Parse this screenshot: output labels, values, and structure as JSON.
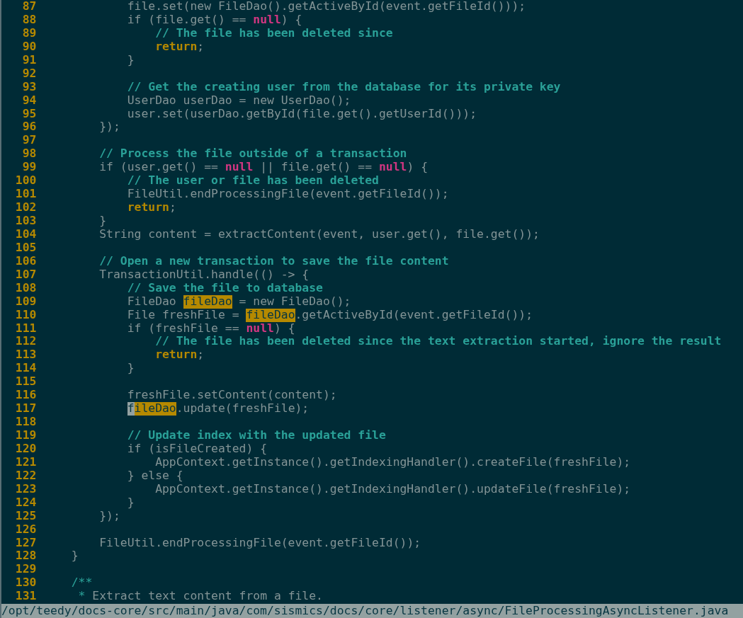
{
  "lines": [
    {
      "number": "87",
      "segments": [
        {
          "text": "            file.set(new FileDao().getActiveById(event.getFileId()));",
          "kind": "code"
        }
      ]
    },
    {
      "number": "88",
      "segments": [
        {
          "text": "            if (file.get() == ",
          "kind": "code"
        },
        {
          "text": "null",
          "kind": "null"
        },
        {
          "text": ") {",
          "kind": "code"
        }
      ]
    },
    {
      "number": "89",
      "segments": [
        {
          "text": "                // The file has been deleted since",
          "kind": "comment"
        }
      ]
    },
    {
      "number": "90",
      "segments": [
        {
          "text": "                return",
          "kind": "return"
        },
        {
          "text": ";",
          "kind": "code"
        }
      ]
    },
    {
      "number": "91",
      "segments": [
        {
          "text": "            }",
          "kind": "code"
        }
      ]
    },
    {
      "number": "92"
    },
    {
      "number": "93",
      "segments": [
        {
          "text": "            // Get the creating user from the database for its private key",
          "kind": "comment"
        }
      ]
    },
    {
      "number": "94",
      "segments": [
        {
          "text": "            UserDao userDao = new UserDao();",
          "kind": "code"
        }
      ]
    },
    {
      "number": "95",
      "segments": [
        {
          "text": "            user.set(userDao.getById(file.get().getUserId()));",
          "kind": "code"
        }
      ]
    },
    {
      "number": "96",
      "segments": [
        {
          "text": "        });",
          "kind": "code"
        }
      ]
    },
    {
      "number": "97"
    },
    {
      "number": "98",
      "segments": [
        {
          "text": "        // Process the file outside of a transaction",
          "kind": "comment"
        }
      ]
    },
    {
      "number": "99",
      "segments": [
        {
          "text": "        if (user.get() == ",
          "kind": "code"
        },
        {
          "text": "null",
          "kind": "null"
        },
        {
          "text": " || file.get() == ",
          "kind": "code"
        },
        {
          "text": "null",
          "kind": "null"
        },
        {
          "text": ") {",
          "kind": "code"
        }
      ]
    },
    {
      "number": "100",
      "segments": [
        {
          "text": "            // The user or file has been deleted",
          "kind": "comment"
        }
      ]
    },
    {
      "number": "101",
      "segments": [
        {
          "text": "            FileUtil.endProcessingFile(event.getFileId());",
          "kind": "code"
        }
      ]
    },
    {
      "number": "102",
      "segments": [
        {
          "text": "            return",
          "kind": "return"
        },
        {
          "text": ";",
          "kind": "code"
        }
      ]
    },
    {
      "number": "103",
      "segments": [
        {
          "text": "        }",
          "kind": "code"
        }
      ]
    },
    {
      "number": "104",
      "segments": [
        {
          "text": "        String content = extractContent(event, user.get(), file.get());",
          "kind": "code"
        }
      ]
    },
    {
      "number": "105"
    },
    {
      "number": "106",
      "segments": [
        {
          "text": "        // Open a new transaction to save the file content",
          "kind": "comment"
        }
      ]
    },
    {
      "number": "107",
      "segments": [
        {
          "text": "        TransactionUtil.handle(() -> {",
          "kind": "code"
        }
      ]
    },
    {
      "number": "108",
      "segments": [
        {
          "text": "            // Save the file to database",
          "kind": "comment"
        }
      ]
    },
    {
      "number": "109",
      "segments": [
        {
          "text": "            FileDao ",
          "kind": "code"
        },
        {
          "text": "fileDao",
          "kind": "match"
        },
        {
          "text": " = new FileDao();",
          "kind": "code"
        }
      ]
    },
    {
      "number": "110",
      "segments": [
        {
          "text": "            File freshFile = ",
          "kind": "code"
        },
        {
          "text": "fileDao",
          "kind": "match"
        },
        {
          "text": ".getActiveById(event.getFileId());",
          "kind": "code"
        }
      ]
    },
    {
      "number": "111",
      "segments": [
        {
          "text": "            if (freshFile == ",
          "kind": "code"
        },
        {
          "text": "null",
          "kind": "null"
        },
        {
          "text": ") {",
          "kind": "code"
        }
      ]
    },
    {
      "number": "112",
      "segments": [
        {
          "text": "                // The file has been deleted since the text extraction started, ignore the result",
          "kind": "comment"
        }
      ]
    },
    {
      "number": "113",
      "segments": [
        {
          "text": "                return",
          "kind": "return"
        },
        {
          "text": ";",
          "kind": "code"
        }
      ]
    },
    {
      "number": "114",
      "segments": [
        {
          "text": "            }",
          "kind": "code"
        }
      ]
    },
    {
      "number": "115"
    },
    {
      "number": "116",
      "segments": [
        {
          "text": "            freshFile.setContent(content);",
          "kind": "code"
        }
      ]
    },
    {
      "number": "117",
      "segments": [
        {
          "text": "            f",
          "kind": "cursor"
        },
        {
          "text": "ileDao",
          "kind": "match"
        },
        {
          "text": ".update(freshFile);",
          "kind": "code"
        }
      ]
    },
    {
      "number": "118"
    },
    {
      "number": "119",
      "segments": [
        {
          "text": "            // Update index with the updated file",
          "kind": "comment"
        }
      ]
    },
    {
      "number": "120",
      "segments": [
        {
          "text": "            if (isFileCreated) {",
          "kind": "code"
        }
      ]
    },
    {
      "number": "121",
      "segments": [
        {
          "text": "                AppContext.getInstance().getIndexingHandler().createFile(freshFile);",
          "kind": "code"
        }
      ]
    },
    {
      "number": "122",
      "segments": [
        {
          "text": "            } else {",
          "kind": "code"
        }
      ]
    },
    {
      "number": "123",
      "segments": [
        {
          "text": "                AppContext.getInstance().getIndexingHandler().updateFile(freshFile);",
          "kind": "code"
        }
      ]
    },
    {
      "number": "124",
      "segments": [
        {
          "text": "            }",
          "kind": "code"
        }
      ]
    },
    {
      "number": "125",
      "segments": [
        {
          "text": "        });",
          "kind": "code"
        }
      ]
    },
    {
      "number": "126"
    },
    {
      "number": "127",
      "segments": [
        {
          "text": "        FileUtil.endProcessingFile(event.getFileId());",
          "kind": "code"
        }
      ]
    },
    {
      "number": "128",
      "segments": [
        {
          "text": "    }",
          "kind": "code"
        }
      ]
    },
    {
      "number": "129"
    },
    {
      "number": "130",
      "segments": [
        {
          "text": "    /**",
          "kind": "doc"
        }
      ]
    },
    {
      "number": "131",
      "segments": [
        {
          "text": "     *",
          "kind": "doc"
        },
        {
          "text": " Extract text content from a file.",
          "kind": "code"
        }
      ]
    }
  ],
  "status_bar": {
    "path": "/opt/teedy/docs-core/src/main/java/com/sismics/docs/core/listener/async/FileProcessingAsyncListener.java"
  }
}
